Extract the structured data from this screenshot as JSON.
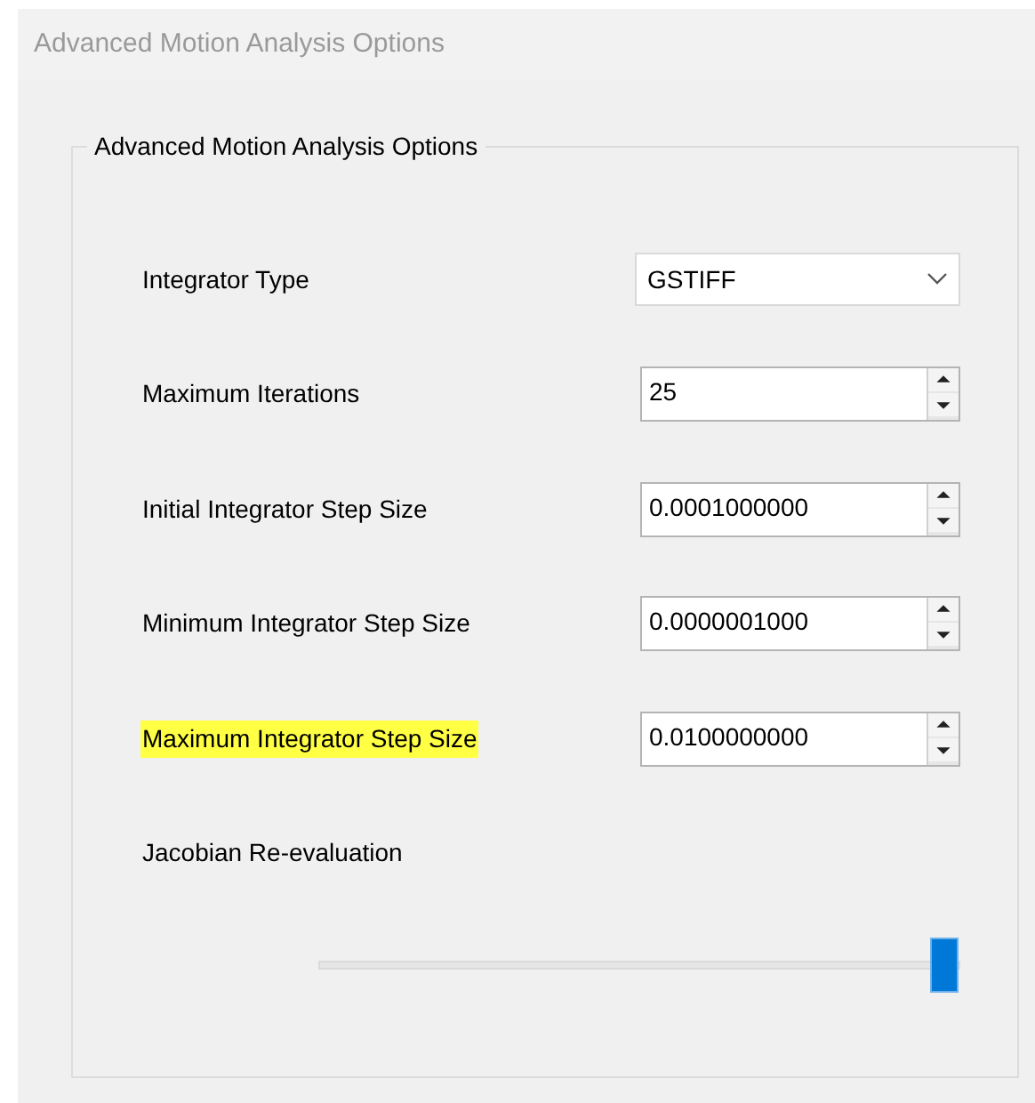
{
  "window": {
    "title": "Advanced Motion Analysis Options",
    "active": false
  },
  "group": {
    "title": "Advanced Motion Analysis Options"
  },
  "rows": [
    {
      "kind": "combo",
      "label": "Integrator Type",
      "highlighted": false,
      "value": "GSTIFF"
    },
    {
      "kind": "spinner",
      "label": "Maximum Iterations",
      "highlighted": false,
      "value": "25"
    },
    {
      "kind": "spinner",
      "label": "Initial Integrator Step Size",
      "highlighted": false,
      "value": "0.0001000000"
    },
    {
      "kind": "spinner",
      "label": "Minimum Integrator Step Size",
      "highlighted": false,
      "value": "0.0000001000"
    },
    {
      "kind": "spinner",
      "label": "Maximum Integrator Step Size",
      "highlighted": true,
      "value": "0.0100000000"
    },
    {
      "kind": "slider",
      "label": "Jacobian Re-evaluation",
      "highlighted": false,
      "level": 1.0
    }
  ]
}
